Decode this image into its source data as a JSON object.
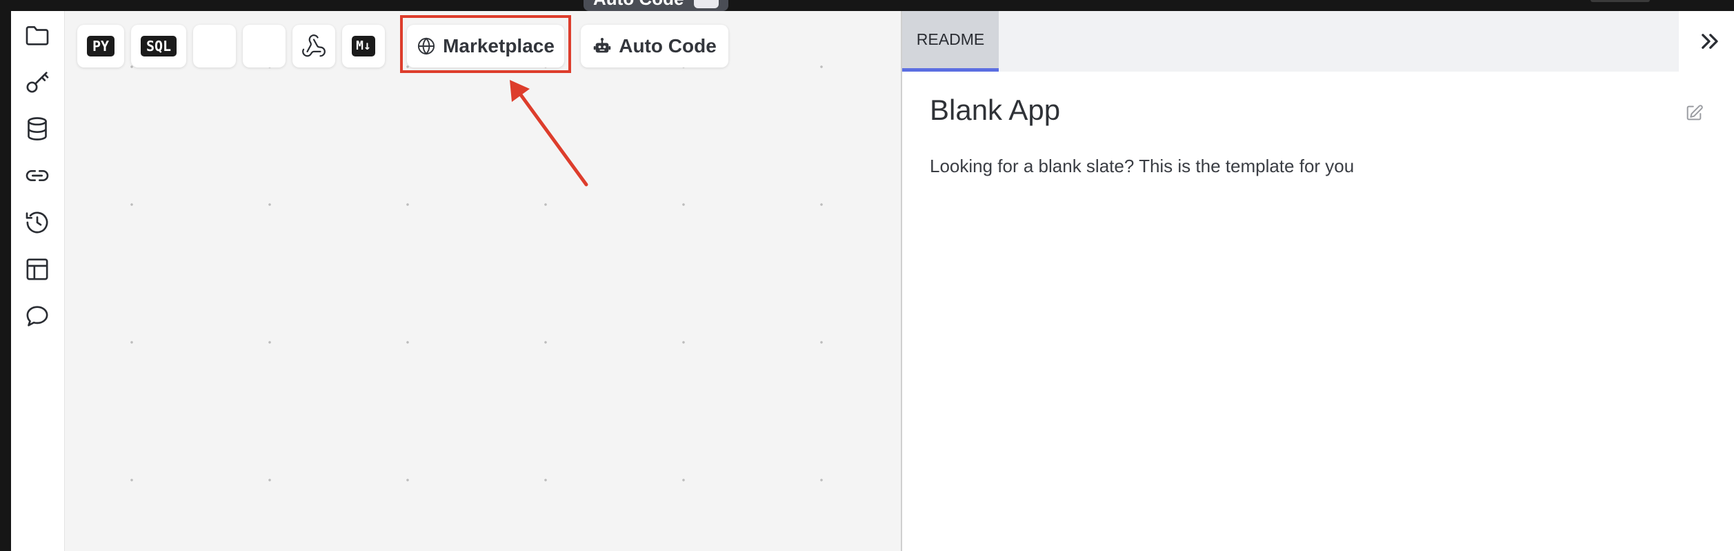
{
  "tooltip": {
    "label": "Auto Code"
  },
  "rail": {
    "icons": [
      "folder-icon",
      "key-icon",
      "database-icon",
      "link-icon",
      "history-icon",
      "layout-icon",
      "chat-icon"
    ]
  },
  "toolbar": {
    "py_label": "PY",
    "sql_label": "SQL",
    "markdown_label": "M↓",
    "marketplace_label": "Marketplace",
    "autocode_label": "Auto Code"
  },
  "annotation": {
    "color": "#dd3d2c"
  },
  "panel": {
    "tabs": [
      {
        "label": "README"
      }
    ],
    "readme": {
      "title": "Blank App",
      "description": "Looking for a blank slate? This is the template for you"
    }
  },
  "colors": {
    "accent": "#5b6ee1",
    "canvas": "#f4f4f4",
    "highlight": "#dd3d2c"
  }
}
